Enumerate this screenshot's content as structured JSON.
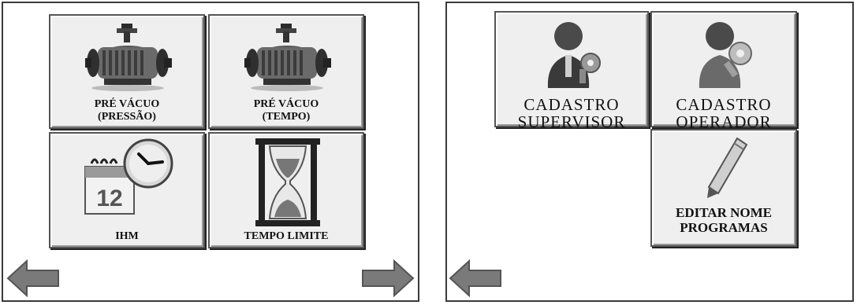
{
  "left_screen": {
    "tiles": [
      {
        "line1": "PRÉ VÁCUO",
        "line2": "(PRESSÃO)",
        "icon": "vacuum-pump-icon"
      },
      {
        "line1": "PRÉ VÁCUO",
        "line2": "(TEMPO)",
        "icon": "vacuum-pump-icon"
      },
      {
        "line1": "IHM",
        "icon": "calendar-clock-icon",
        "calendar_number": "12"
      },
      {
        "line1": "TEMPO LIMITE",
        "icon": "hourglass-icon"
      }
    ],
    "nav": {
      "back": "arrow-left-icon",
      "forward": "arrow-right-icon"
    }
  },
  "right_screen": {
    "tiles": [
      {
        "line1": "CADASTRO",
        "line2": "SUPERVISOR",
        "icon": "user-key-icon"
      },
      {
        "line1": "CADASTRO",
        "line2": "OPERADOR",
        "icon": "user-key-icon"
      },
      {
        "line1": "EDITAR NOME",
        "line2": "PROGRAMAS",
        "icon": "pencil-icon"
      }
    ],
    "nav": {
      "back": "arrow-left-icon"
    }
  },
  "colors": {
    "tile_bg": "#efefef",
    "arrow": "#7a7a7a",
    "border": "#3a3a3a"
  }
}
